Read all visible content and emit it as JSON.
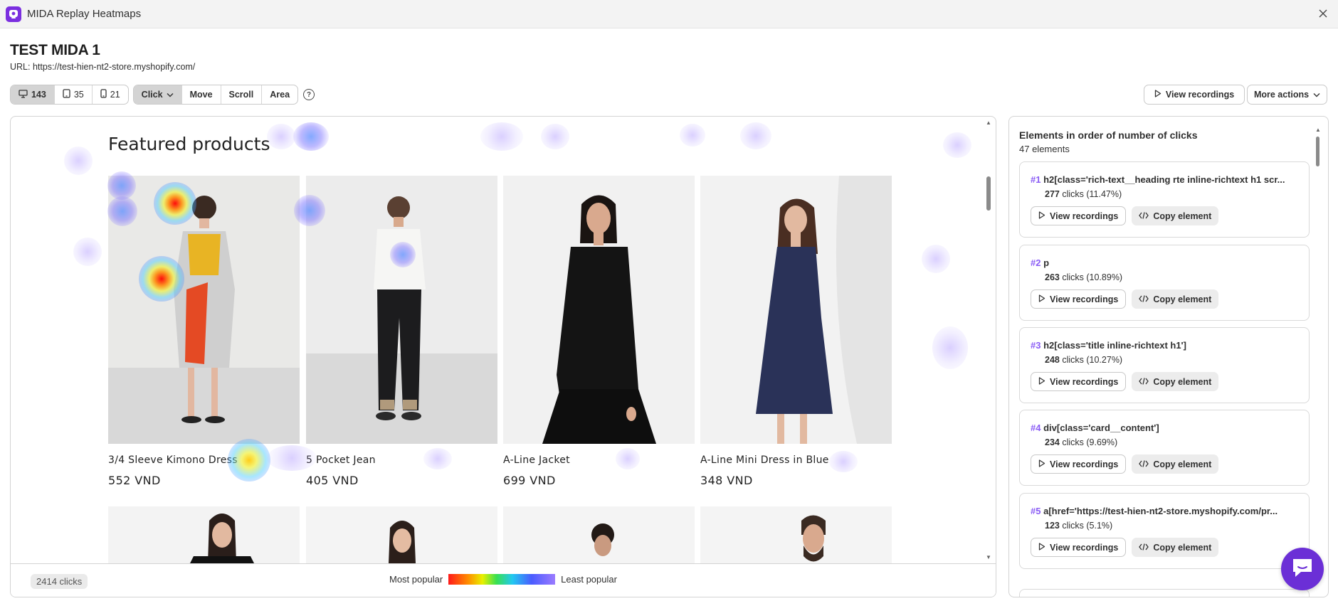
{
  "window": {
    "title": "MIDA Replay Heatmaps"
  },
  "page": {
    "title": "TEST MIDA 1",
    "url": "URL: https://test-hien-nt2-store.myshopify.com/"
  },
  "devices": [
    {
      "icon": "desktop-icon",
      "count": "143",
      "active": true
    },
    {
      "icon": "tablet-icon",
      "count": "35",
      "active": false
    },
    {
      "icon": "mobile-icon",
      "count": "21",
      "active": false
    }
  ],
  "modes": [
    {
      "label": "Click",
      "active": true,
      "has_dropdown": true
    },
    {
      "label": "Move",
      "active": false
    },
    {
      "label": "Scroll",
      "active": false
    },
    {
      "label": "Area",
      "active": false
    }
  ],
  "actions": {
    "view_recordings": "View recordings",
    "more_actions": "More actions"
  },
  "preview": {
    "heading": "Featured products",
    "products": [
      {
        "name": "3/4 Sleeve Kimono Dress",
        "price": "552 VND"
      },
      {
        "name": "5 Pocket Jean",
        "price": "405 VND"
      },
      {
        "name": "A-Line Jacket",
        "price": "699 VND"
      },
      {
        "name": "A-Line Mini Dress in Blue",
        "price": "348 VND"
      }
    ],
    "footer": {
      "clicks": "2414 clicks",
      "most": "Most popular",
      "least": "Least popular"
    }
  },
  "panel": {
    "title": "Elements in order of number of clicks",
    "subtitle": "47 elements",
    "view_label": "View recordings",
    "copy_label": "Copy element",
    "elements": [
      {
        "rank": "#1",
        "selector": "h2[class='rich-text__heading rte inline-richtext h1 scr...",
        "clicks": "277",
        "pct": "clicks (11.47%)"
      },
      {
        "rank": "#2",
        "selector": "p",
        "clicks": "263",
        "pct": "clicks (10.89%)"
      },
      {
        "rank": "#3",
        "selector": "h2[class='title inline-richtext h1']",
        "clicks": "248",
        "pct": "clicks (10.27%)"
      },
      {
        "rank": "#4",
        "selector": "div[class='card__content']",
        "clicks": "234",
        "pct": "clicks (9.69%)"
      },
      {
        "rank": "#5",
        "selector": "a[href='https://test-hien-nt2-store.myshopify.com/pr...",
        "clicks": "123",
        "pct": "clicks (5.1%)"
      }
    ]
  },
  "colors": {
    "brand": "#7b2fe0",
    "rank": "#8a5cf5",
    "chat": "#6b2fd6"
  }
}
